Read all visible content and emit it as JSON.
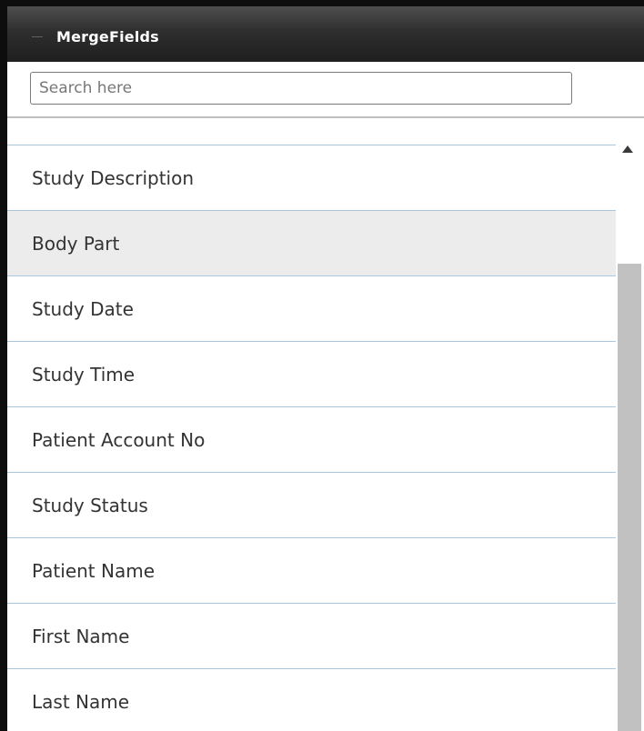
{
  "panel": {
    "title": "MergeFields"
  },
  "search": {
    "placeholder": "Search here",
    "value": ""
  },
  "merge_fields": {
    "items": [
      {
        "label": "Study Description",
        "selected": false
      },
      {
        "label": "Body Part",
        "selected": true
      },
      {
        "label": "Study Date",
        "selected": false
      },
      {
        "label": "Study Time",
        "selected": false
      },
      {
        "label": "Patient Account No",
        "selected": false
      },
      {
        "label": "Study Status",
        "selected": false
      },
      {
        "label": "Patient Name",
        "selected": false
      },
      {
        "label": "First Name",
        "selected": false
      },
      {
        "label": "Last Name",
        "selected": false
      }
    ]
  },
  "icons": {
    "collapse": "minus-icon",
    "scroll_up": "scroll-up-arrow-icon"
  },
  "colors": {
    "header_bg": "#2e2e2e",
    "header_text": "#ffffff",
    "row_divider": "#a9c8de",
    "selected_row_bg": "#ececec",
    "scroll_thumb": "#c1c1c1"
  }
}
